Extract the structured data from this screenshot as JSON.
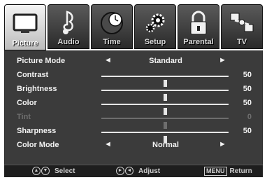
{
  "tabs": [
    {
      "label": "Picture",
      "icon": "tv-icon",
      "active": true
    },
    {
      "label": "Audio",
      "icon": "music-note-icon",
      "active": false
    },
    {
      "label": "Time",
      "icon": "clock-icon",
      "active": false
    },
    {
      "label": "Setup",
      "icon": "gears-icon",
      "active": false
    },
    {
      "label": "Parental",
      "icon": "lock-icon",
      "active": false
    },
    {
      "label": "TV",
      "icon": "satellite-icon",
      "active": false
    }
  ],
  "settings": {
    "picture_mode": {
      "label": "Picture Mode",
      "value": "Standard",
      "left_arrow": "◄",
      "right_arrow": "►"
    },
    "contrast": {
      "label": "Contrast",
      "value": "50",
      "level": 0.5
    },
    "brightness": {
      "label": "Brightness",
      "value": "50",
      "level": 0.5
    },
    "color": {
      "label": "Color",
      "value": "50",
      "level": 0.5
    },
    "tint": {
      "label": "Tint",
      "value": "0",
      "level": 0.5
    },
    "sharpness": {
      "label": "Sharpness",
      "value": "50",
      "level": 0.5
    },
    "color_mode": {
      "label": "Color Mode",
      "value": "Normal",
      "left_arrow": "◄",
      "right_arrow": "►"
    }
  },
  "footer": {
    "select_label": "Select",
    "adjust_label": "Adjust",
    "menu_key": "MENU",
    "return_label": "Return",
    "up_glyph": "▲",
    "down_glyph": "▼",
    "right_glyph": "►",
    "left_glyph": "◄"
  },
  "colors": {
    "panel_bg": "#3b3b3b",
    "active_tab": "#d8d8d8",
    "text": "#f2f2f2",
    "dim_text": "#6e6e6e"
  }
}
